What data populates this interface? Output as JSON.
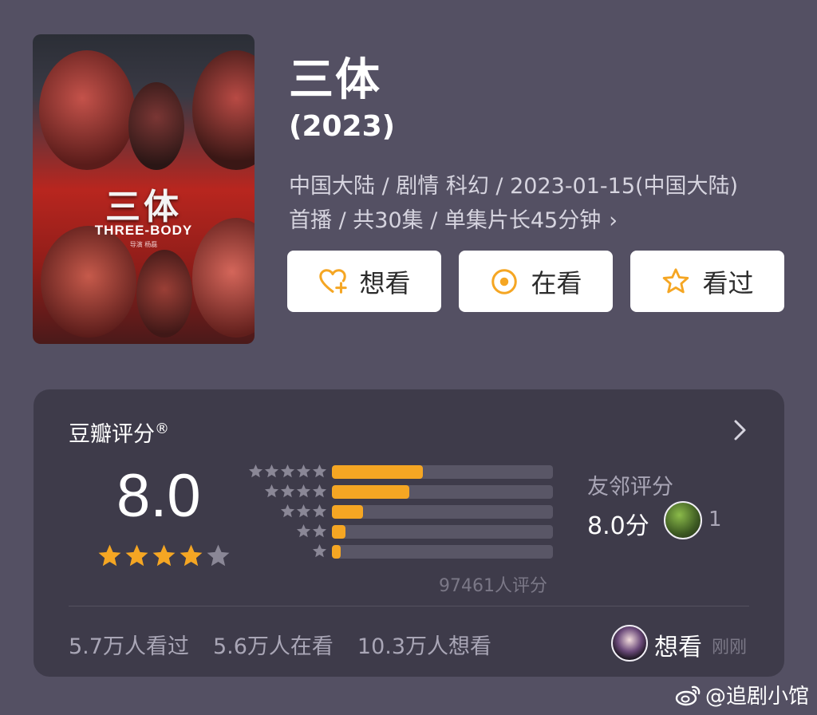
{
  "poster": {
    "title_cn": "三体",
    "title_en": "THREE-BODY",
    "credit": "导演 杨磊"
  },
  "header": {
    "title": "三体",
    "year": "(2023)",
    "meta_line1": "中国大陆 / 剧情 科幻 / 2023-01-15(中国大陆)",
    "meta_line2": "首播 / 共30集 / 单集片长45分钟",
    "chevron": "›"
  },
  "actions": {
    "want": "想看",
    "watching": "在看",
    "watched": "看过",
    "accent_color": "#f5a623"
  },
  "rating": {
    "label": "豆瓣评分",
    "registered": "®",
    "score": "8.0",
    "stars_filled": 4,
    "stars_total": 5,
    "distribution": [
      {
        "stars": 5,
        "percent": 41
      },
      {
        "stars": 4,
        "percent": 35
      },
      {
        "stars": 3,
        "percent": 14
      },
      {
        "stars": 2,
        "percent": 6
      },
      {
        "stars": 1,
        "percent": 4
      }
    ],
    "raters": "97461人评分",
    "friend_label": "友邻评分",
    "friend_score": "8.0分",
    "friend_count": "1"
  },
  "stats": {
    "watched": "5.7万人看过",
    "watching": "5.6万人在看",
    "want": "10.3万人想看"
  },
  "recent": {
    "action": "想看",
    "time": "刚刚"
  },
  "watermark": "@追剧小馆",
  "colors": {
    "background": "#545063",
    "card": "#3e3b4a",
    "star": "#f5a623",
    "star_empty": "#8a8796"
  }
}
